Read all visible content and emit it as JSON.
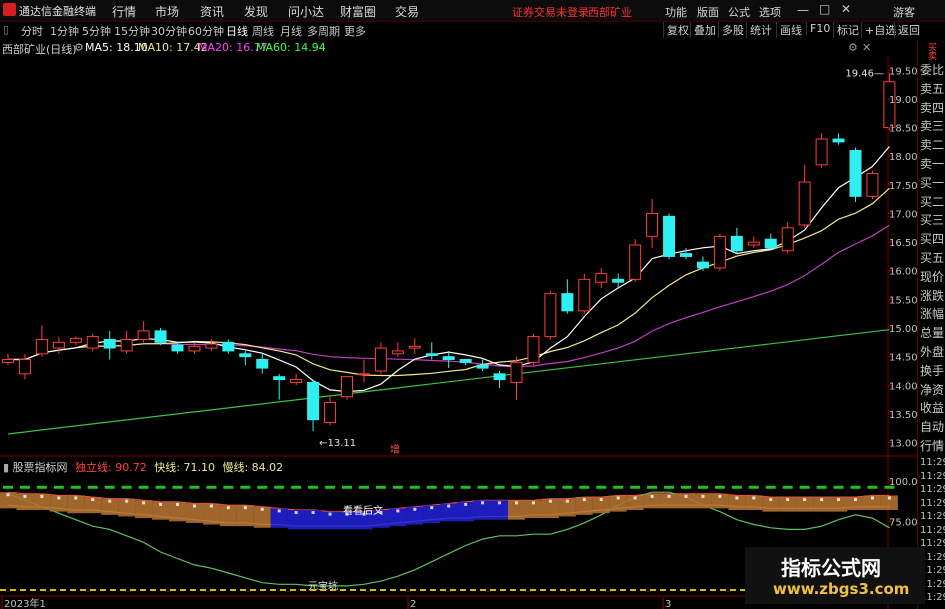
{
  "app": {
    "title": "通达信金融终端"
  },
  "menu": {
    "items": [
      "行情",
      "市场",
      "资讯",
      "发现",
      "问小达",
      "财富圈",
      "交易"
    ],
    "notice": "证券交易未登录",
    "stock": "西部矿业",
    "right": [
      "功能",
      "版面",
      "公式",
      "选项"
    ],
    "guest": "游客"
  },
  "toolbar": {
    "periods": [
      "分时",
      "1分钟",
      "5分钟",
      "15分钟",
      "30分钟",
      "60分钟",
      "日线",
      "周线",
      "月线",
      "多周期",
      "更多"
    ],
    "active": "日线",
    "right": [
      "复权",
      "叠加",
      "多股",
      "统计",
      "画线",
      "F10",
      "标记",
      "+自选",
      "返回"
    ]
  },
  "info": {
    "name": "西部矿业(日线)",
    "ma5": "MA5: 18.10",
    "ma10": "MA10: 17.42",
    "ma20": "MA20: 16.77",
    "ma60": "MA60: 14.94",
    "colors": {
      "ma5": "#ffffff",
      "ma10": "#f0e68c",
      "ma20": "#ff40ff",
      "ma60": "#40ff40"
    }
  },
  "chart_data": {
    "type": "candlestick",
    "price_axis": {
      "ticks": [
        "19.50",
        "19.00",
        "18.50",
        "18.00",
        "17.50",
        "17.00",
        "16.50",
        "16.00",
        "15.50",
        "15.00",
        "14.50",
        "14.00",
        "13.50",
        "13.00"
      ],
      "range": [
        12.8,
        19.75
      ]
    },
    "candles": [
      {
        "o": 14.4,
        "c": 14.45,
        "h": 14.55,
        "l": 14.35
      },
      {
        "o": 14.2,
        "c": 14.45,
        "h": 14.55,
        "l": 14.1
      },
      {
        "o": 14.55,
        "c": 14.8,
        "h": 15.05,
        "l": 14.5
      },
      {
        "o": 14.65,
        "c": 14.75,
        "h": 14.85,
        "l": 14.55
      },
      {
        "o": 14.75,
        "c": 14.82,
        "h": 14.85,
        "l": 14.7
      },
      {
        "o": 14.65,
        "c": 14.85,
        "h": 14.9,
        "l": 14.6
      },
      {
        "o": 14.8,
        "c": 14.65,
        "h": 14.95,
        "l": 14.45
      },
      {
        "o": 14.6,
        "c": 14.8,
        "h": 14.95,
        "l": 14.55
      },
      {
        "o": 14.8,
        "c": 14.95,
        "h": 15.12,
        "l": 14.75
      },
      {
        "o": 14.95,
        "c": 14.75,
        "h": 15.0,
        "l": 14.7
      },
      {
        "o": 14.7,
        "c": 14.6,
        "h": 14.75,
        "l": 14.55
      },
      {
        "o": 14.6,
        "c": 14.68,
        "h": 14.75,
        "l": 14.55
      },
      {
        "o": 14.65,
        "c": 14.72,
        "h": 14.8,
        "l": 14.6
      },
      {
        "o": 14.75,
        "c": 14.6,
        "h": 14.8,
        "l": 14.55
      },
      {
        "o": 14.55,
        "c": 14.5,
        "h": 14.6,
        "l": 14.35
      },
      {
        "o": 14.45,
        "c": 14.3,
        "h": 14.55,
        "l": 14.2
      },
      {
        "o": 14.15,
        "c": 14.1,
        "h": 14.2,
        "l": 13.75
      },
      {
        "o": 14.05,
        "c": 14.1,
        "h": 14.2,
        "l": 14.0
      },
      {
        "o": 14.05,
        "c": 13.4,
        "h": 14.1,
        "l": 13.2
      },
      {
        "o": 13.35,
        "c": 13.7,
        "h": 13.8,
        "l": 13.3
      },
      {
        "o": 13.8,
        "c": 14.15,
        "h": 14.15,
        "l": 13.75
      },
      {
        "o": 14.2,
        "c": 14.2,
        "h": 14.45,
        "l": 14.05
      },
      {
        "o": 14.25,
        "c": 14.65,
        "h": 14.75,
        "l": 14.2
      },
      {
        "o": 14.55,
        "c": 14.6,
        "h": 14.75,
        "l": 14.5
      },
      {
        "o": 14.65,
        "c": 14.68,
        "h": 14.82,
        "l": 14.55
      },
      {
        "o": 14.55,
        "c": 14.52,
        "h": 14.75,
        "l": 14.45
      },
      {
        "o": 14.5,
        "c": 14.45,
        "h": 14.6,
        "l": 14.3
      },
      {
        "o": 14.45,
        "c": 14.4,
        "h": 14.45,
        "l": 14.35
      },
      {
        "o": 14.35,
        "c": 14.3,
        "h": 14.45,
        "l": 14.25
      },
      {
        "o": 14.2,
        "c": 14.1,
        "h": 14.25,
        "l": 13.95
      },
      {
        "o": 14.05,
        "c": 14.4,
        "h": 14.5,
        "l": 13.75
      },
      {
        "o": 14.4,
        "c": 14.85,
        "h": 14.9,
        "l": 14.35
      },
      {
        "o": 14.85,
        "c": 15.6,
        "h": 15.65,
        "l": 14.8
      },
      {
        "o": 15.6,
        "c": 15.3,
        "h": 15.85,
        "l": 15.25
      },
      {
        "o": 15.3,
        "c": 15.85,
        "h": 15.95,
        "l": 15.25
      },
      {
        "o": 15.8,
        "c": 15.95,
        "h": 16.05,
        "l": 15.7
      },
      {
        "o": 15.85,
        "c": 15.8,
        "h": 15.95,
        "l": 15.7
      },
      {
        "o": 15.85,
        "c": 16.45,
        "h": 16.55,
        "l": 15.8
      },
      {
        "o": 16.6,
        "c": 17.0,
        "h": 17.25,
        "l": 16.4
      },
      {
        "o": 16.95,
        "c": 16.25,
        "h": 17.0,
        "l": 16.2
      },
      {
        "o": 16.3,
        "c": 16.25,
        "h": 16.4,
        "l": 16.2
      },
      {
        "o": 16.15,
        "c": 16.05,
        "h": 16.25,
        "l": 16.0
      },
      {
        "o": 16.05,
        "c": 16.6,
        "h": 16.65,
        "l": 16.0
      },
      {
        "o": 16.6,
        "c": 16.35,
        "h": 16.75,
        "l": 16.3
      },
      {
        "o": 16.45,
        "c": 16.5,
        "h": 16.6,
        "l": 16.4
      },
      {
        "o": 16.55,
        "c": 16.4,
        "h": 16.65,
        "l": 16.35
      },
      {
        "o": 16.35,
        "c": 16.75,
        "h": 16.85,
        "l": 16.3
      },
      {
        "o": 16.8,
        "c": 17.55,
        "h": 17.85,
        "l": 16.75
      },
      {
        "o": 17.85,
        "c": 18.3,
        "h": 18.4,
        "l": 17.8
      },
      {
        "o": 18.3,
        "c": 18.25,
        "h": 18.4,
        "l": 18.2
      },
      {
        "o": 18.1,
        "c": 17.3,
        "h": 18.15,
        "l": 17.2
      },
      {
        "o": 17.3,
        "c": 17.7,
        "h": 17.75,
        "l": 17.25
      },
      {
        "o": 18.5,
        "c": 19.3,
        "h": 19.46,
        "l": 18.45
      }
    ],
    "ma_colors": {
      "ma5": "#ffffff",
      "ma10": "#f0e68c",
      "ma20": "#c040c0",
      "ma60": "#40c040"
    },
    "annotations": {
      "high": "19.46",
      "low": "13.11",
      "marker": "增"
    },
    "indicator": {
      "name": "股票指标网",
      "independent_label": "独立线: 90.72",
      "fast_label": "快线: 71.10",
      "slow_label": "慢线: 84.02",
      "axis_ticks": [
        "100.0",
        "75.00",
        "50.00"
      ],
      "range": [
        30,
        108
      ],
      "fast": [
        92,
        88,
        84,
        80,
        76,
        72,
        70,
        66,
        62,
        56,
        52,
        48,
        46,
        43,
        40,
        37,
        36,
        36,
        35,
        35,
        35,
        36,
        38,
        41,
        45,
        50,
        55,
        60,
        64,
        66,
        66,
        67,
        67,
        70,
        74,
        79,
        85,
        90,
        93,
        93,
        90,
        85,
        81,
        76,
        73,
        71,
        70,
        70,
        72,
        76,
        79,
        77,
        71
      ],
      "slow": [
        85,
        84,
        84,
        83,
        82,
        82,
        81,
        80,
        79,
        78,
        77,
        76,
        75,
        74,
        74,
        73,
        73,
        72,
        72,
        72,
        72,
        72,
        73,
        74,
        75,
        76,
        77,
        77,
        78,
        78,
        78,
        79,
        79,
        80,
        81,
        82,
        83,
        84,
        85,
        85,
        85,
        85,
        85,
        84,
        84,
        83,
        83,
        83,
        83,
        83,
        84,
        84,
        84
      ],
      "independent": [
        93,
        92,
        92,
        91,
        91,
        90,
        89,
        89,
        88,
        87,
        87,
        86,
        86,
        85,
        85,
        84,
        83,
        82,
        82,
        81,
        81,
        81,
        82,
        83,
        84,
        85,
        86,
        87,
        88,
        88,
        88,
        88,
        89,
        89,
        90,
        90,
        91,
        91,
        92,
        92,
        92,
        92,
        92,
        91,
        91,
        90,
        90,
        90,
        90,
        90,
        90,
        91,
        91
      ],
      "labels": {
        "bottom_pit": "元宝坑",
        "watch": "看看后文"
      }
    },
    "date_axis": [
      "2023年1",
      "2",
      "3"
    ]
  },
  "side_panel": {
    "top_labels": [
      "买",
      "卖"
    ],
    "items": [
      "委比",
      "卖五",
      "卖四",
      "卖三",
      "卖二",
      "卖一",
      "买一",
      "买二",
      "买三",
      "买四",
      "买五",
      "现价",
      "涨跌",
      "涨幅",
      "总量",
      "外盘",
      "换手",
      "净资",
      "收益",
      "自动",
      "行情"
    ],
    "times": [
      "11:29",
      "11:29",
      "11:29",
      "11:29",
      "11:29",
      "11:29",
      "11:29",
      "11:29",
      "11:29",
      "11:29",
      "11:29"
    ]
  },
  "watermark": {
    "title": "指标公式网",
    "url": "www.zbgs3.com"
  }
}
